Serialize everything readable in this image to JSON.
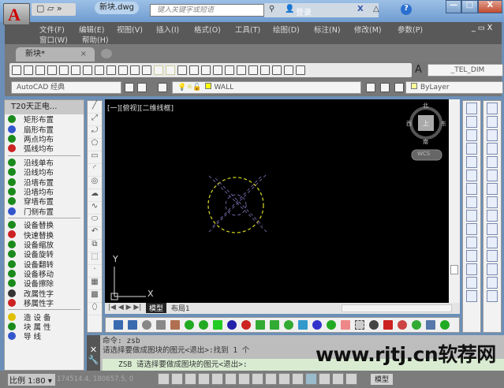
{
  "titlebar": {
    "doc_tab": "新块.dwg",
    "search_placeholder": "键入关键字或短语",
    "login": "登录",
    "help": "?",
    "minimize": "—",
    "maximize": "□",
    "close": "X"
  },
  "menu": {
    "items": [
      "文件(F)",
      "编辑(E)",
      "视图(V)",
      "插入(I)",
      "格式(O)",
      "工具(T)",
      "绘图(D)",
      "标注(N)",
      "修改(M)",
      "参数(P)"
    ],
    "row2": [
      "窗口(W)",
      "帮助(H)"
    ],
    "doc_controls": "_ ▭ X"
  },
  "file_tab": {
    "label": "新块*",
    "close": "×"
  },
  "toolbar": {
    "dimstyle": "_TEL_DIM",
    "workspace": "AutoCAD 经典",
    "layer": "WALL",
    "color": "ByLayer"
  },
  "left_panel": {
    "title": "T20天正电...",
    "groups": [
      [
        {
          "label": "矩形布置",
          "color": "#1a8a1a"
        },
        {
          "label": "扇形布置",
          "color": "#3355cc"
        },
        {
          "label": "两点均布",
          "color": "#1a8a1a"
        },
        {
          "label": "弧线均布",
          "color": "#cc2222"
        }
      ],
      [
        {
          "label": "沿线单布",
          "color": "#1a8a1a"
        },
        {
          "label": "沿线均布",
          "color": "#1a8a1a"
        },
        {
          "label": "沿墙布置",
          "color": "#1a8a1a"
        },
        {
          "label": "沿墙均布",
          "color": "#1a8a1a"
        },
        {
          "label": "穿墙布置",
          "color": "#1a8a1a"
        },
        {
          "label": "门侧布置",
          "color": "#3355cc"
        }
      ],
      [
        {
          "label": "设备替换",
          "color": "#1a8a1a"
        },
        {
          "label": "快速替换",
          "color": "#cc2222"
        },
        {
          "label": "设备缩放",
          "color": "#1a8a1a"
        },
        {
          "label": "设备旋转",
          "color": "#1a8a1a"
        },
        {
          "label": "设备翻转",
          "color": "#1a8a1a"
        },
        {
          "label": "设备移动",
          "color": "#1a8a1a"
        },
        {
          "label": "设备擦除",
          "color": "#1a8a1a"
        },
        {
          "label": "改属性字",
          "color": "#333333"
        },
        {
          "label": "移属性字",
          "color": "#cc2222"
        }
      ],
      [
        {
          "label": "造 设 备",
          "color": "#e0c000"
        },
        {
          "label": "块 属 性",
          "color": "#1a8a1a"
        },
        {
          "label": "导   线",
          "color": "#3355cc"
        }
      ]
    ]
  },
  "viewport": {
    "label": "[一][俯视][二维线框]",
    "compass": {
      "n": "北",
      "s": "南",
      "e": "东",
      "w": "西",
      "center": "上"
    },
    "ucs": "WCS",
    "axis_x": "X",
    "axis_y": "Y"
  },
  "layout_tabs": [
    "模型",
    "布局1"
  ],
  "command": {
    "history": [
      "命令: zsb",
      "请选择要做成图块的图元<退出>:找到 1 个"
    ],
    "prompt": "ZSB 请选择要做成图块的图元<退出>:"
  },
  "watermark": "www.rjtj.cn软荐网",
  "status": {
    "scale": "比例 1:80 ▾",
    "coords": "174514.4, 180657.5, 0",
    "model": "模型"
  }
}
